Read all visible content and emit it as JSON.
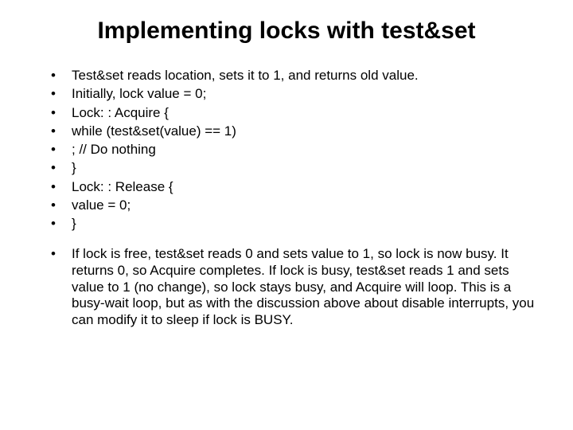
{
  "title": "Implementing locks with test&set",
  "bullets": [
    "Test&set reads location, sets it to 1, and returns old value.",
    "Initially, lock value = 0;",
    "Lock: : Acquire {",
    "while (test&set(value) == 1)",
    "; // Do nothing",
    "}",
    "Lock: : Release {",
    "value = 0;",
    "}"
  ],
  "paragraph": [
    "If lock is free, test&set reads 0 and sets value to 1, so lock is now busy. It returns 0, so Acquire completes. If lock is busy, test&set reads 1 and sets value to 1 (no change), so lock stays busy, and Acquire will loop. This is a busy-wait loop, but as with the discussion above about disable interrupts, you can modify it to sleep if lock is BUSY."
  ]
}
